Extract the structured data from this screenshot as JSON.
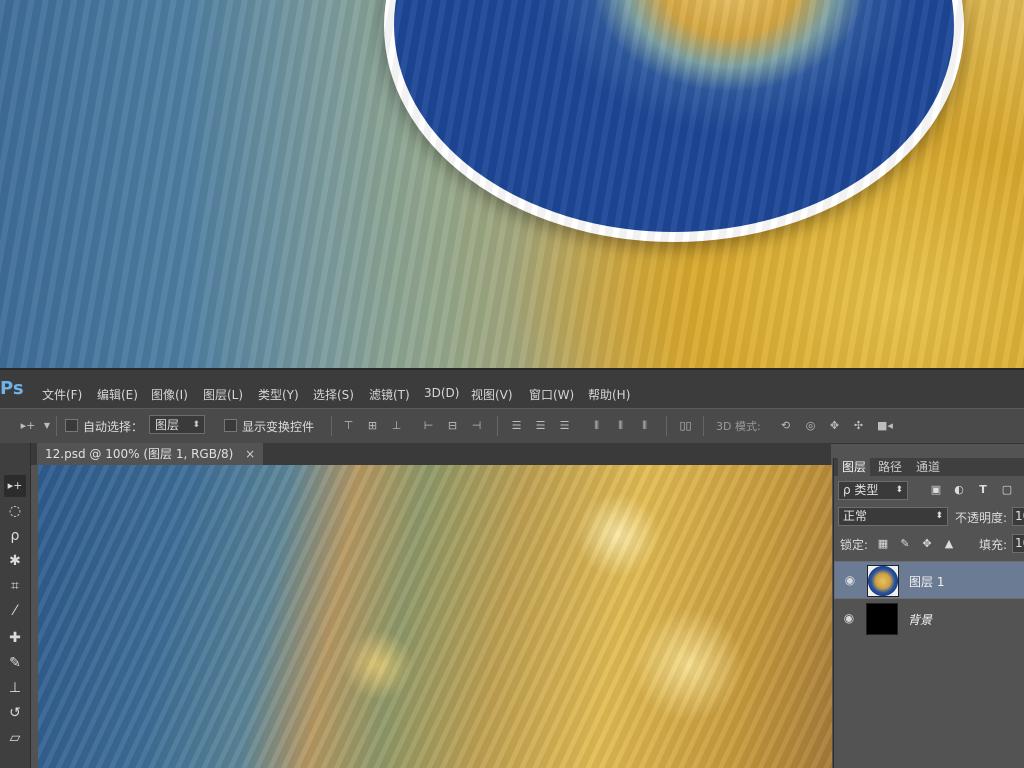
{
  "app": {
    "logo": "Ps"
  },
  "menu": [
    "文件(F)",
    "编辑(E)",
    "图像(I)",
    "图层(L)",
    "类型(Y)",
    "选择(S)",
    "滤镜(T)",
    "3D(D)",
    "视图(V)",
    "窗口(W)",
    "帮助(H)"
  ],
  "options": {
    "auto_select_label": "自动选择：",
    "auto_select_value": "图层",
    "show_transform_label": "显示变换控件",
    "mode_3d_label": "3D 模式:"
  },
  "document": {
    "tab_title": "12.psd @ 100% (图层 1, RGB/8)",
    "close_glyph": "×"
  },
  "tools": [
    {
      "name": "move-tool",
      "glyph": "▸+"
    },
    {
      "name": "marquee-tool",
      "glyph": "◌"
    },
    {
      "name": "lasso-tool",
      "glyph": "ρ"
    },
    {
      "name": "magic-wand-tool",
      "glyph": "✱"
    },
    {
      "name": "crop-tool",
      "glyph": "⌗"
    },
    {
      "name": "eyedropper-tool",
      "glyph": "⁄"
    },
    {
      "name": "healing-brush-tool",
      "glyph": "✚"
    },
    {
      "name": "brush-tool",
      "glyph": "✎"
    },
    {
      "name": "clone-stamp-tool",
      "glyph": "⊥"
    },
    {
      "name": "history-brush-tool",
      "glyph": "↺"
    },
    {
      "name": "eraser-tool",
      "glyph": "▱"
    }
  ],
  "layers_panel": {
    "tabs": [
      "图层",
      "路径",
      "通道"
    ],
    "filter_kind": "ρ 类型",
    "blend_mode": "正常",
    "opacity_label": "不透明度:",
    "opacity_value": "10",
    "lock_label": "锁定:",
    "fill_label": "填充:",
    "fill_value": "10",
    "layers": [
      {
        "name": "图层 1",
        "selected": true
      },
      {
        "name": "背景",
        "selected": false
      }
    ]
  },
  "colors": {
    "accent": "#6fb2e8",
    "selected_layer": "#6b7b94",
    "plate_blue": "#1d4797",
    "gold": "#e3bd54"
  }
}
